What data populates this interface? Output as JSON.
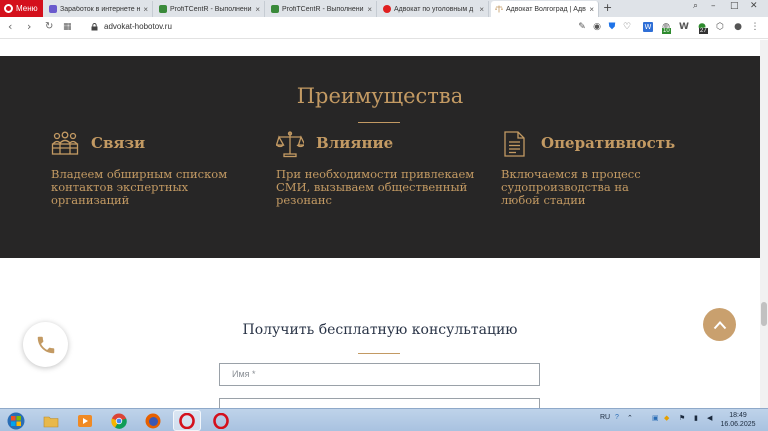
{
  "browser": {
    "menu_label": "Меню",
    "tabs": [
      {
        "label": "Заработок в интернете н",
        "fav": "sp-icon",
        "color": "#6a5acd",
        "active": false
      },
      {
        "label": "ProfiTCentR - Выполнени",
        "fav": "chart-icon",
        "color": "#3a8a3a",
        "active": false
      },
      {
        "label": "ProfiTCentR - Выполнени",
        "fav": "chart-icon",
        "color": "#3a8a3a",
        "active": false
      },
      {
        "label": "Адвокат по уголовным д",
        "fav": "yandex-icon",
        "color": "#e02020",
        "active": false
      },
      {
        "label": "Адвокат Волгоград | Адво",
        "fav": "scales-icon",
        "color": "#c39a63",
        "active": true
      }
    ],
    "url": "advokat-hobotov.ru",
    "badges": {
      "ext1": "10",
      "ext2": "27"
    }
  },
  "page": {
    "advantages_title": "Преимущества",
    "features": [
      {
        "title": "Связи",
        "text": "Владеем обширным списком контактов экспертных организаций",
        "icon": "people-icon"
      },
      {
        "title": "Влияние",
        "text": "При необходимости привлекаем СМИ, вызываем общественный резонанс",
        "icon": "scales-icon"
      },
      {
        "title": "Оперативность",
        "text": "Включаемся в процесс судопроизводства на любой стадии",
        "icon": "document-icon"
      }
    ],
    "consult_title": "Получить бесплатную консультацию",
    "name_placeholder": "Имя *",
    "phone_placeholder": ""
  },
  "taskbar": {
    "lang": "RU",
    "time": "18:49",
    "date": "16.06.2025"
  },
  "colors": {
    "gold": "#c39a63",
    "dark_bg": "#272626",
    "brand_red": "#d4101c"
  }
}
